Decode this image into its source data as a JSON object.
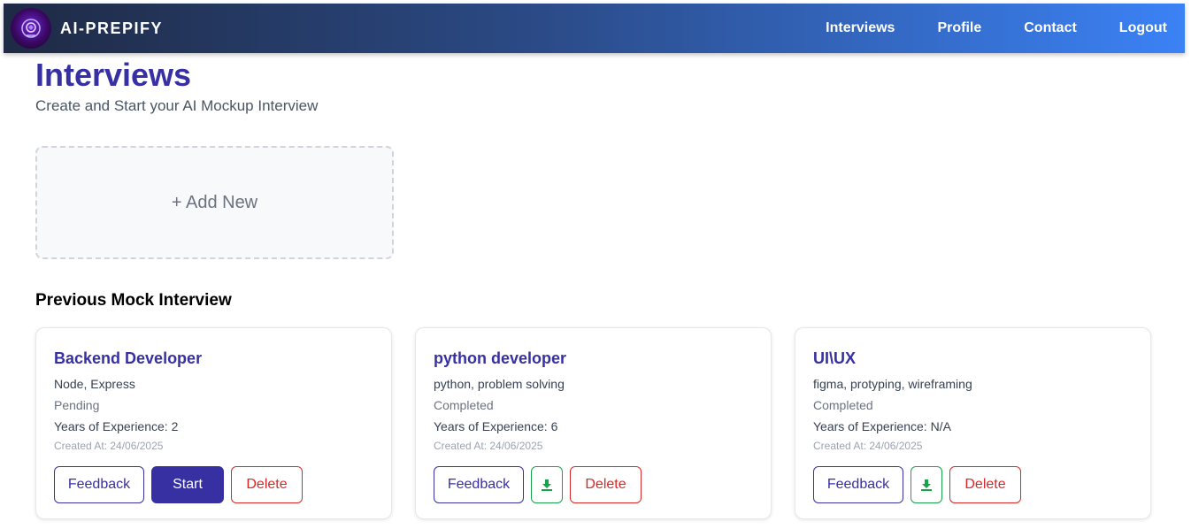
{
  "app": {
    "brand_name": "AI-PREPIFY",
    "logo_icon": "brain-head-icon"
  },
  "nav": {
    "items": [
      {
        "label": "Interviews"
      },
      {
        "label": "Profile"
      },
      {
        "label": "Contact"
      },
      {
        "label": "Logout"
      }
    ]
  },
  "header": {
    "title": "Interviews",
    "subtitle": "Create and Start your AI Mockup Interview"
  },
  "add_new": {
    "label": "+ Add New"
  },
  "previous": {
    "title": "Previous Mock Interview",
    "cards": [
      {
        "title": "Backend Developer",
        "skills": "Node, Express",
        "status": "Pending",
        "experience": "Years of Experience: 2",
        "created": "Created At: 24/06/2025",
        "feedback_label": "Feedback",
        "start_label": "Start",
        "delete_label": "Delete"
      },
      {
        "title": "python developer",
        "skills": "python, problem solving",
        "status": "Completed",
        "experience": "Years of Experience: 6",
        "created": "Created At: 24/06/2025",
        "feedback_label": "Feedback",
        "download_icon": "download-icon",
        "delete_label": "Delete"
      },
      {
        "title": "UI\\UX",
        "skills": "figma, protyping, wireframing",
        "status": "Completed",
        "experience": "Years of Experience: N/A",
        "created": "Created At: 24/06/2025",
        "feedback_label": "Feedback",
        "download_icon": "download-icon",
        "delete_label": "Delete"
      }
    ]
  },
  "colors": {
    "primary": "#3730a3",
    "danger": "#dc2626",
    "success": "#16a34a",
    "nav_gradient_start": "#1f2a44",
    "nav_gradient_end": "#3b82f6"
  }
}
